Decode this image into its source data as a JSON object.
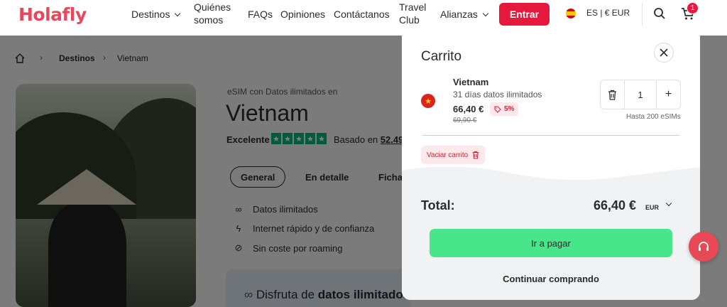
{
  "brand": {
    "logo_text": "Holafly",
    "color": "#e6485c"
  },
  "nav": {
    "items": [
      {
        "label": "Destinos"
      },
      {
        "label_line1": "Quiénes",
        "label_line2": "somos"
      },
      {
        "label": "FAQs"
      },
      {
        "label": "Opiniones"
      },
      {
        "label": "Contáctanos"
      },
      {
        "label_line1": "Travel",
        "label_line2": "Club"
      },
      {
        "label": "Alianzas"
      }
    ],
    "login_label": "Entrar",
    "locale_label": "ES | € EUR",
    "cart_count": "1"
  },
  "breadcrumb": {
    "items": [
      "Destinos",
      "Vietnam"
    ]
  },
  "product": {
    "tag": "eSIM con Datos ilimitados en",
    "title": "Vietnam",
    "rating_word": "Excelente",
    "stars": 5,
    "based_prefix": "Basado en",
    "based_count": "52.49",
    "tabs": [
      "General",
      "En detalle",
      "Ficha"
    ],
    "features": [
      "Datos ilimitados",
      "Internet rápido y de confianza",
      "Sin coste por roaming"
    ],
    "promo_prefix": "Disfruta de",
    "promo_bold": "datos ilimitados"
  },
  "cart": {
    "title": "Carrito",
    "item": {
      "name": "Vietnam",
      "subtitle": "31 días datos ilimitados",
      "price": "66,40 €",
      "discount": "5%",
      "old_price": "69,90 €",
      "quantity": "1",
      "limit_note": "Hasta 200 eSIMs"
    },
    "empty_label": "Vaciar carrito",
    "total_label": "Total:",
    "total_amount": "66,40 €",
    "total_currency": "EUR",
    "pay_label": "Ir a pagar",
    "continue_label": "Continuar comprando",
    "colors": {
      "pay": "#48e58a",
      "accent": "#e6183c"
    }
  }
}
